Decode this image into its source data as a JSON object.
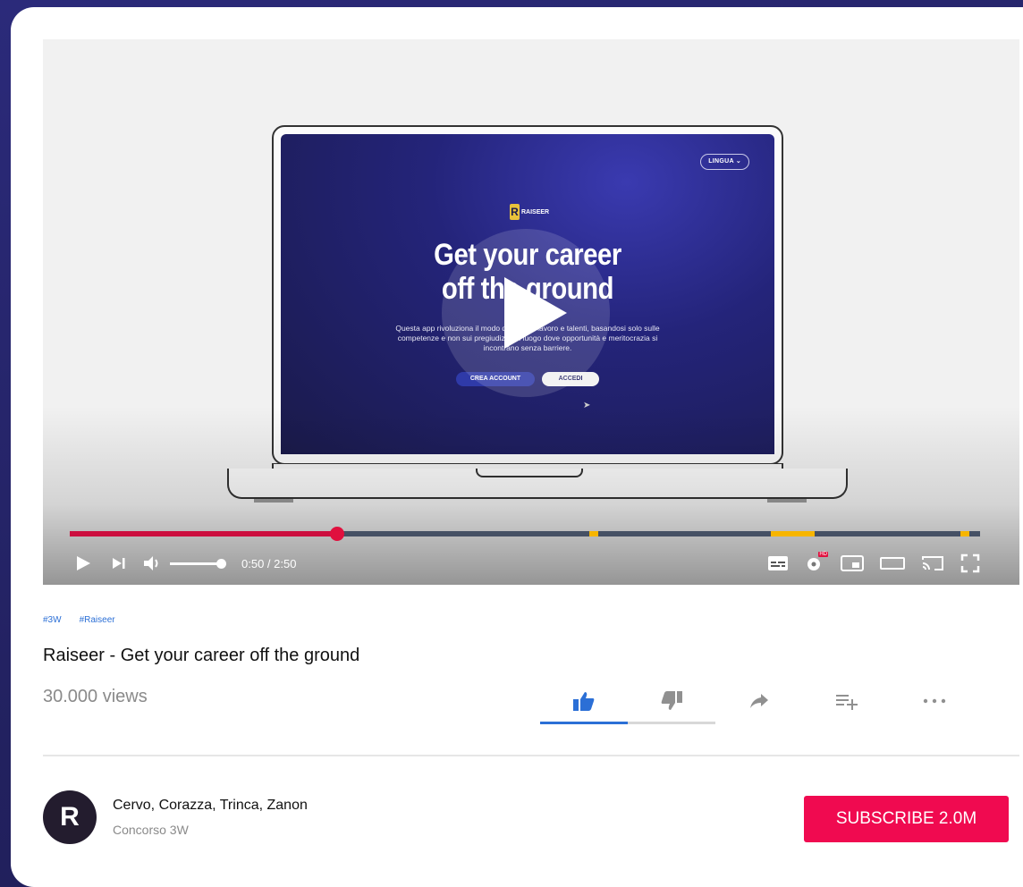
{
  "video": {
    "screen": {
      "language_button": "LINGUA",
      "brand_name": "RAISEER",
      "brand_letter": "R",
      "headline_line1": "Get your career",
      "headline_line2": "off the ground",
      "description": "Questa app rivoluziona il modo di cercare lavoro e talenti, basandosi solo sulle competenze e non sui pregiudizi. Un luogo dove opportunità e meritocrazia si incontrano senza barriere.",
      "create_account_button": "CREA ACCOUNT",
      "login_button": "ACCEDI"
    },
    "progress_fraction": 0.294,
    "chapter_markers_fraction": [
      0.571,
      0.77,
      0.81,
      0.978
    ],
    "time_display": "0:50 / 2:50",
    "volume_fraction": 1.0,
    "quality_badge": "HD",
    "accent_color": "#cc0d3e",
    "marker_color": "#f7b500"
  },
  "tags": [
    "#3W",
    "#Raiseer"
  ],
  "title": "Raiseer - Get your career off the ground",
  "views": "30.000 views",
  "actions": [
    "like-icon",
    "dislike-icon",
    "share-icon",
    "add-to-playlist-icon",
    "more-icon"
  ],
  "like_color": "#2b6fd6",
  "channel": {
    "name": "Cervo, Corazza, Trinca, Zanon",
    "subtitle": "Concorso 3W",
    "avatar_letter": "R"
  },
  "subscribe": {
    "label": "SUBSCRIBE 2.0M",
    "color": "#f00a50"
  }
}
